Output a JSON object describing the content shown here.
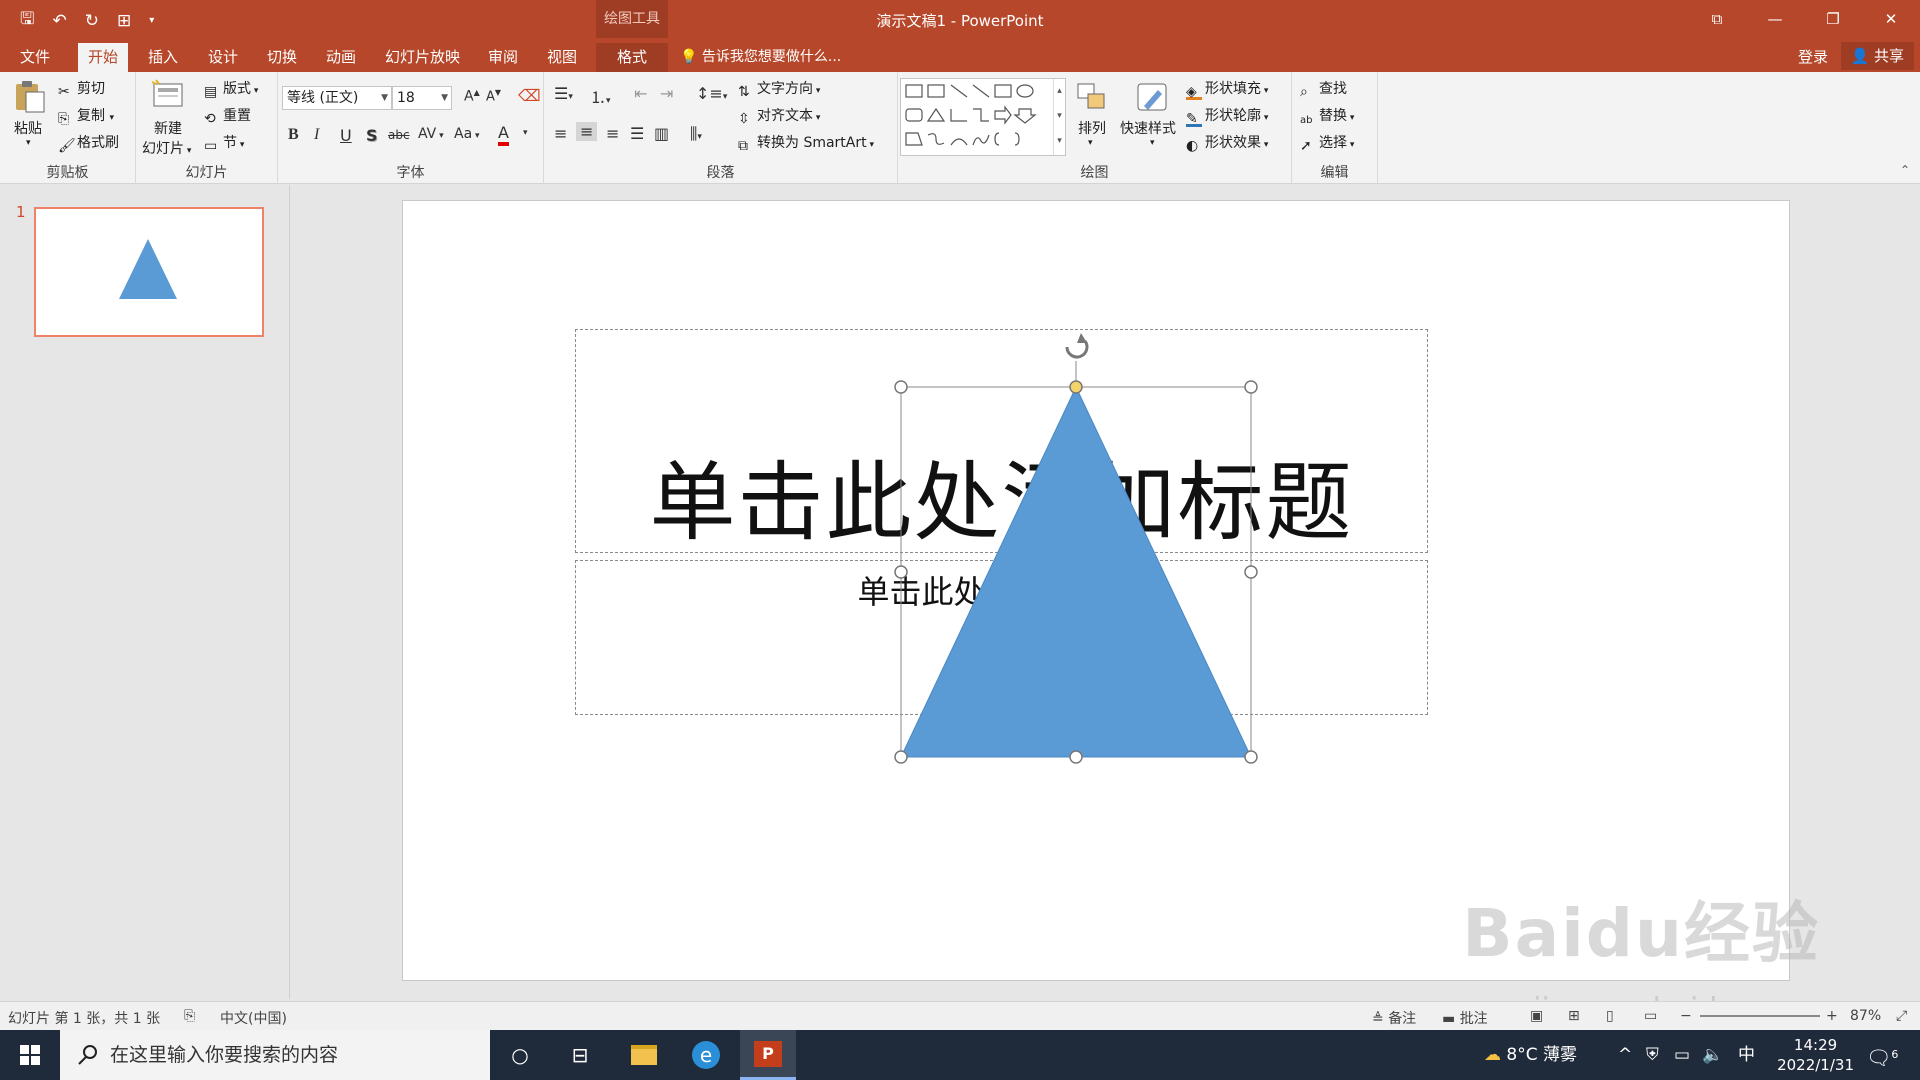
{
  "titlebar": {
    "context_tool": "绘图工具",
    "title": "演示文稿1 - PowerPoint"
  },
  "tabs": {
    "file": "文件",
    "home": "开始",
    "insert": "插入",
    "design": "设计",
    "transitions": "切换",
    "animations": "动画",
    "slideshow": "幻灯片放映",
    "review": "审阅",
    "view": "视图",
    "format": "格式",
    "tellme": "告诉我您想要做什么...",
    "login": "登录",
    "share": "共享"
  },
  "ribbon": {
    "clipboard": {
      "paste": "粘贴",
      "cut": "剪切",
      "copy": "复制",
      "format_painter": "格式刷",
      "label": "剪贴板"
    },
    "slides": {
      "new_slide_1": "新建",
      "new_slide_2": "幻灯片",
      "layout": "版式",
      "reset": "重置",
      "section": "节",
      "label": "幻灯片"
    },
    "font": {
      "name": "等线 (正文)",
      "size": "18",
      "bold": "B",
      "italic": "I",
      "underline": "U",
      "shadow": "S",
      "strike": "abc",
      "spacing": "AV",
      "case": "Aa",
      "color": "A",
      "label": "字体"
    },
    "paragraph": {
      "text_direction": "文字方向",
      "align_text": "对齐文本",
      "smartart": "转换为 SmartArt",
      "label": "段落"
    },
    "drawing": {
      "arrange": "排列",
      "quick_styles": "快速样式",
      "fill": "形状填充",
      "outline": "形状轮廓",
      "effects": "形状效果",
      "label": "绘图"
    },
    "editing": {
      "find": "查找",
      "replace": "替换",
      "select": "选择",
      "label": "编辑"
    }
  },
  "thumbnails": {
    "number": "1"
  },
  "slide": {
    "title_placeholder": "单击此处添加标题",
    "subtitle_placeholder": "单击此处添加副标题",
    "shape_fill": "#5b9bd5"
  },
  "statusbar": {
    "slide_info": "幻灯片 第 1 张，共 1 张",
    "language": "中文(中国)",
    "notes": "备注",
    "comments": "批注",
    "zoom": "87%"
  },
  "taskbar": {
    "search_placeholder": "在这里输入你要搜索的内容",
    "weather": "8°C  薄雾",
    "ime": "中",
    "time": "14:29",
    "date": "2022/1/31",
    "notifications": "6"
  },
  "watermark": {
    "brand": "Baidu经验",
    "url": "jingyan.baidu.com"
  },
  "colors": {
    "accent": "#b7472a",
    "accent_dark": "#9e3c24",
    "shape": "#5b9bd5"
  }
}
